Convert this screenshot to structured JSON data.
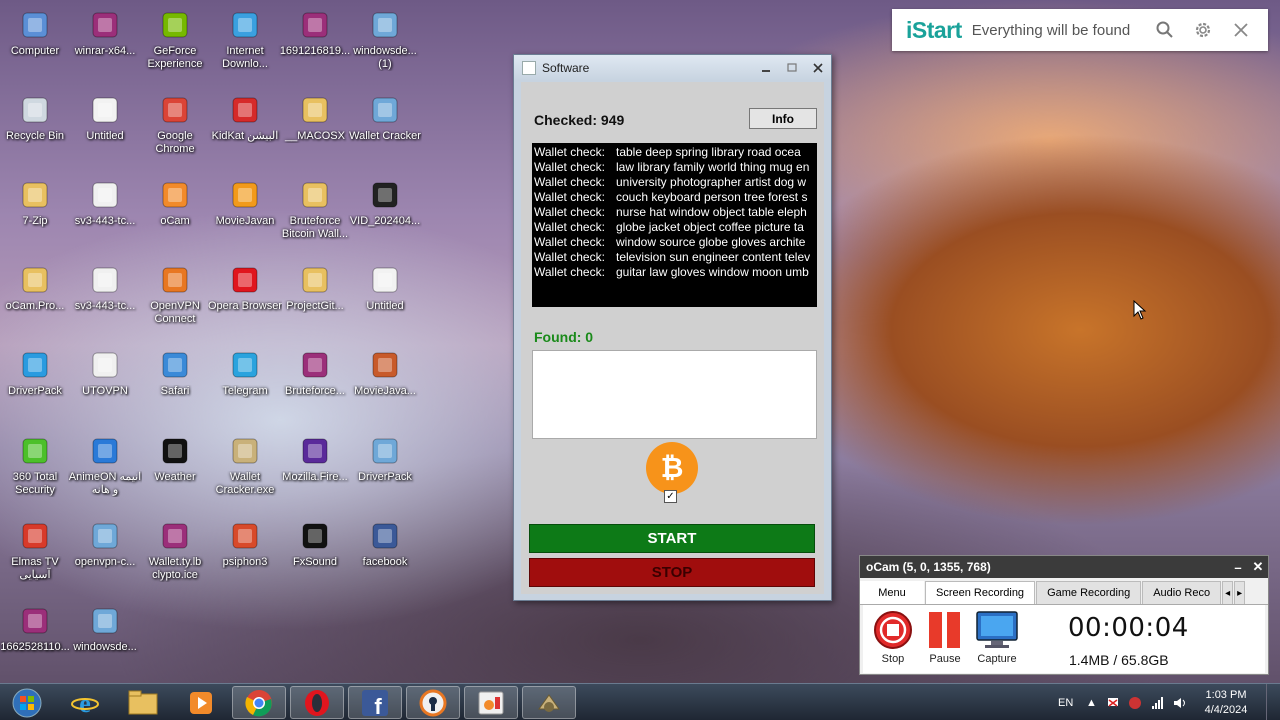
{
  "desktop_icons": [
    {
      "label": "Computer",
      "icon": "computer-icon"
    },
    {
      "label": "winrar-x64...",
      "icon": "winrar-icon"
    },
    {
      "label": "GeForce Experience",
      "icon": "geforce-icon"
    },
    {
      "label": "Internet Downlo...",
      "icon": "idm-icon"
    },
    {
      "label": "1691216819...",
      "icon": "winrar-icon"
    },
    {
      "label": "windowsde... (1)",
      "icon": "installer-icon"
    },
    {
      "label": "Recycle Bin",
      "icon": "recycle-bin-icon"
    },
    {
      "label": "Untitled",
      "icon": "file-icon"
    },
    {
      "label": "Google Chrome",
      "icon": "chrome-icon"
    },
    {
      "label": "KidKat البيشن",
      "icon": "kidkat-icon"
    },
    {
      "label": "__MACOSX",
      "icon": "folder-icon"
    },
    {
      "label": "Wallet Cracker",
      "icon": "installer-icon"
    },
    {
      "label": "7-Zip",
      "icon": "folder-icon"
    },
    {
      "label": "sv3-443-tc...",
      "icon": "vpn-file-icon"
    },
    {
      "label": "oCam",
      "icon": "ocam-icon"
    },
    {
      "label": "MovieJavan",
      "icon": "moviejavan-icon"
    },
    {
      "label": "Bruteforce Bitcoin Wall...",
      "icon": "folder-icon"
    },
    {
      "label": "VID_202404...",
      "icon": "video-file-icon"
    },
    {
      "label": "oCam.Pro...",
      "icon": "folder-icon"
    },
    {
      "label": "sv3-443-tc...",
      "icon": "vpn-file-icon"
    },
    {
      "label": "OpenVPN Connect",
      "icon": "openvpn-icon"
    },
    {
      "label": "Opera Browser",
      "icon": "opera-icon"
    },
    {
      "label": "ProjectGit...",
      "icon": "folder-icon"
    },
    {
      "label": "Untitled",
      "icon": "file-icon"
    },
    {
      "label": "DriverPack",
      "icon": "driverpack-icon"
    },
    {
      "label": "UTOVPN",
      "icon": "vpn-file-icon"
    },
    {
      "label": "Safari",
      "icon": "safari-icon"
    },
    {
      "label": "Telegram",
      "icon": "telegram-icon"
    },
    {
      "label": "Bruteforce...",
      "icon": "winrar-icon"
    },
    {
      "label": "MovieJava...",
      "icon": "moviejava-icon"
    },
    {
      "label": "360 Total Security",
      "icon": "360-security-icon"
    },
    {
      "label": "AnimeON انیمه و هانه",
      "icon": "animeon-icon"
    },
    {
      "label": "Weather",
      "icon": "weather-icon"
    },
    {
      "label": "Wallet Cracker.exe",
      "icon": "wallet-cracker-icon"
    },
    {
      "label": "Mozilla.Fire...",
      "icon": "firefox-setup-icon"
    },
    {
      "label": "DriverPack",
      "icon": "installer-icon"
    },
    {
      "label": "Elmas TV آسیایی",
      "icon": "elmas-tv-icon"
    },
    {
      "label": "openvpn-c...",
      "icon": "installer-icon"
    },
    {
      "label": "Wallet.ty.lb clypto.ice",
      "icon": "winrar-icon"
    },
    {
      "label": "psiphon3",
      "icon": "psiphon-icon"
    },
    {
      "label": "FxSound",
      "icon": "fxsound-icon"
    },
    {
      "label": "facebook",
      "icon": "facebook-icon"
    },
    {
      "label": "1662528110...",
      "icon": "winrar-icon"
    },
    {
      "label": "windowsde...",
      "icon": "installer-icon"
    }
  ],
  "istart": {
    "brand": "iStart",
    "tagline": "Everything will be found"
  },
  "software_window": {
    "title": "Software",
    "checked_label": "Checked: 949",
    "info_button": "Info",
    "log": [
      {
        "k": "Wallet check:",
        "v": "table deep spring library road ocea"
      },
      {
        "k": "Wallet check:",
        "v": "law library family world thing mug en"
      },
      {
        "k": "Wallet check:",
        "v": "university photographer artist dog w"
      },
      {
        "k": "Wallet check:",
        "v": "couch keyboard person tree forest s"
      },
      {
        "k": "Wallet check:",
        "v": "nurse hat window object table eleph"
      },
      {
        "k": "Wallet check:",
        "v": "globe jacket object coffee picture ta"
      },
      {
        "k": "Wallet check:",
        "v": "window source globe gloves archite"
      },
      {
        "k": "Wallet check:",
        "v": "television sun engineer content telev"
      },
      {
        "k": "Wallet check:",
        "v": "guitar law gloves window moon umb"
      }
    ],
    "found_label": "Found: 0",
    "bitcoin_symbol": "₿",
    "checkbox_checked": true,
    "start_button": "START",
    "stop_button": "STOP"
  },
  "ocam": {
    "title": "oCam (5, 0, 1355, 768)",
    "tabs": [
      "Menu",
      "Screen Recording",
      "Game Recording",
      "Audio Reco"
    ],
    "active_tab": "Screen Recording",
    "buttons": [
      "Stop",
      "Pause",
      "Capture"
    ],
    "timer": "00:00:04",
    "size": "1.4MB / 65.8GB"
  },
  "taskbar": {
    "apps": [
      "start-orb-icon",
      "internet-explorer-icon",
      "file-explorer-icon",
      "media-player-icon",
      "chrome-icon",
      "opera-icon",
      "facebook-icon",
      "openvpn-icon",
      "ocam-icon",
      "wallet-cracker-icon"
    ],
    "language": "EN",
    "time": "1:03 PM",
    "date": "4/4/2024"
  }
}
